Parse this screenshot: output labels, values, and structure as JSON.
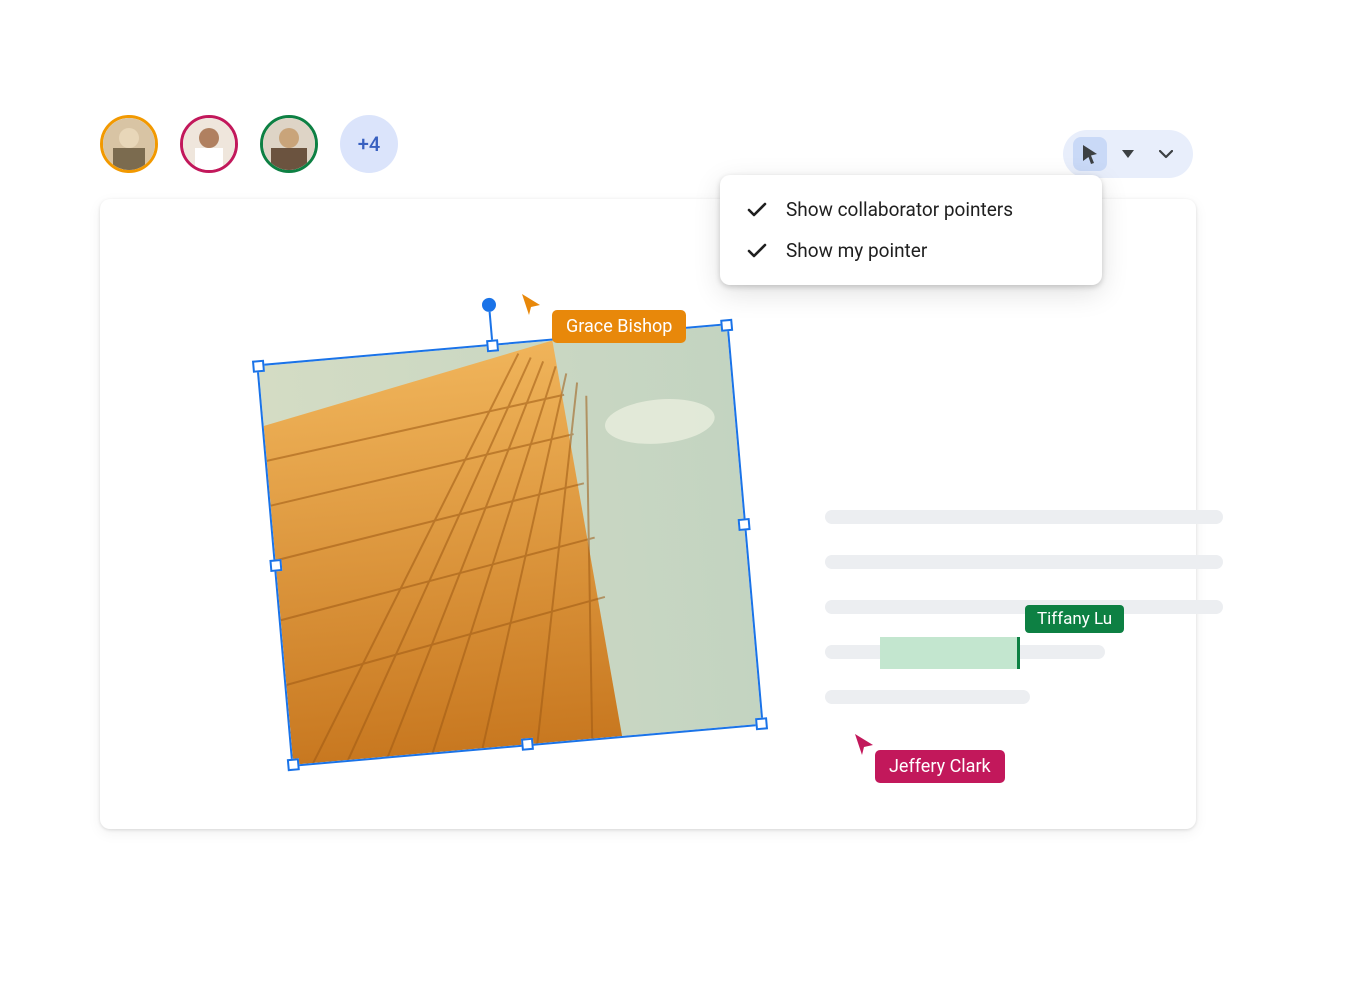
{
  "avatars": {
    "ring_colors": [
      "#f29900",
      "#c2185b",
      "#0d8043"
    ],
    "more_label": "+4"
  },
  "collaborators": {
    "grace": {
      "name": "Grace Bishop",
      "color": "#e8880a"
    },
    "jeffery": {
      "name": "Jeffery Clark",
      "color": "#c2185b"
    },
    "tiffany": {
      "name": "Tiffany Lu",
      "color": "#0d8043"
    }
  },
  "menu": {
    "item1": "Show collaborator pointers",
    "item2": "Show my pointer"
  },
  "toolbar": {
    "cursor_icon": "cursor-icon",
    "dropdown_icon": "dropdown-icon",
    "chevron_icon": "chevron-down-icon"
  }
}
